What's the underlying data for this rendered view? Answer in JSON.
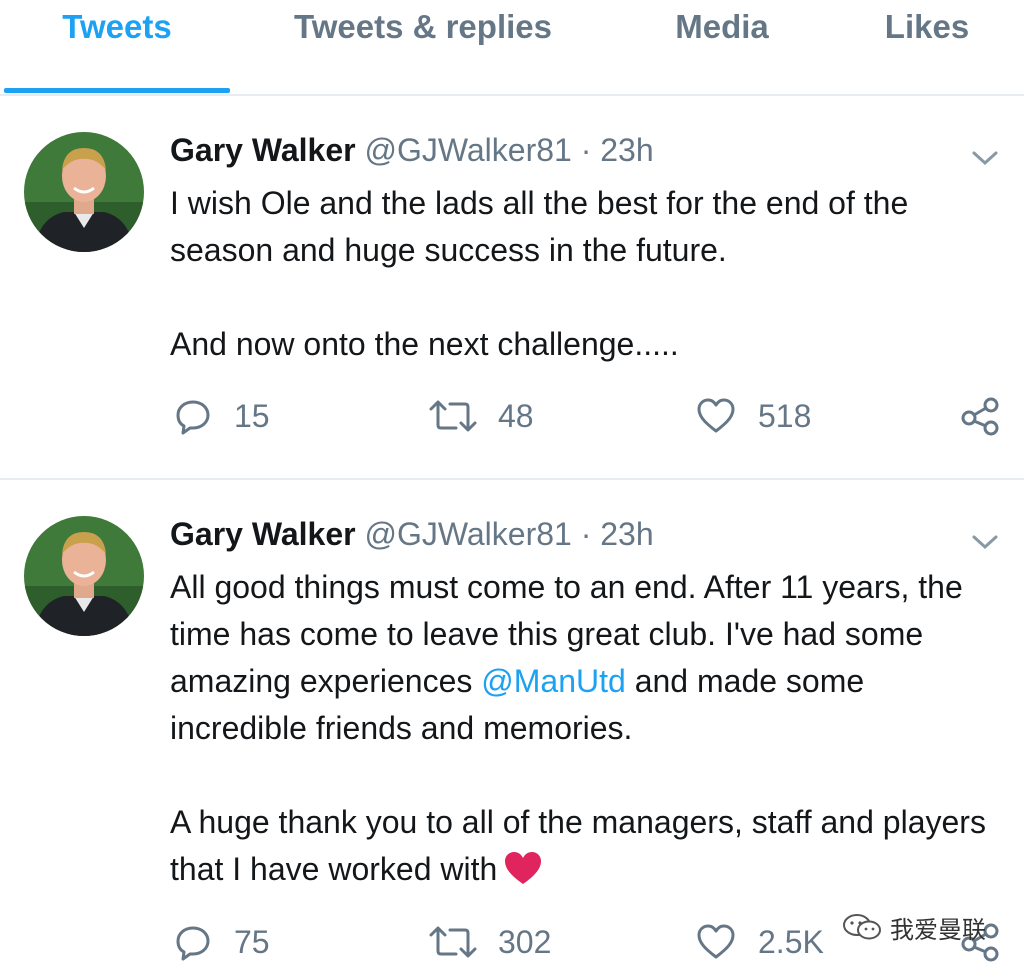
{
  "tabs": [
    {
      "label": "Tweets",
      "active": true
    },
    {
      "label": "Tweets & replies",
      "active": false
    },
    {
      "label": "Media",
      "active": false
    },
    {
      "label": "Likes",
      "active": false
    }
  ],
  "tweets": [
    {
      "author_name": "Gary Walker",
      "author_handle": "@GJWalker81",
      "separator": "·",
      "time": "23h",
      "text_line1": "I wish Ole and the lads all the best for the end of the season and huge success in the future.",
      "text_line2": "And now onto the next challenge.....",
      "replies": "15",
      "retweets": "48",
      "likes": "518"
    },
    {
      "author_name": "Gary Walker",
      "author_handle": "@GJWalker81",
      "separator": "·",
      "time": "23h",
      "text_p1_before": "All good things must come to an end. After 11 years, the time has come to leave this great club. I've had some amazing experiences ",
      "text_p1_mention": "@ManUtd",
      "text_p1_after": " and made some incredible friends and memories.",
      "text_p2": "A huge thank you to all of the managers, staff and players that I have worked with",
      "replies": "75",
      "retweets": "302",
      "likes": "2.5K"
    }
  ],
  "watermark": {
    "text": "我爱曼联"
  },
  "colors": {
    "accent": "#1da1f2",
    "muted": "#657786",
    "divider": "#e6ecf0",
    "heart": "#e0245e"
  },
  "icons": [
    "reply-icon",
    "retweet-icon",
    "like-icon",
    "share-icon",
    "caret-down-icon",
    "heart-emoji-icon"
  ]
}
